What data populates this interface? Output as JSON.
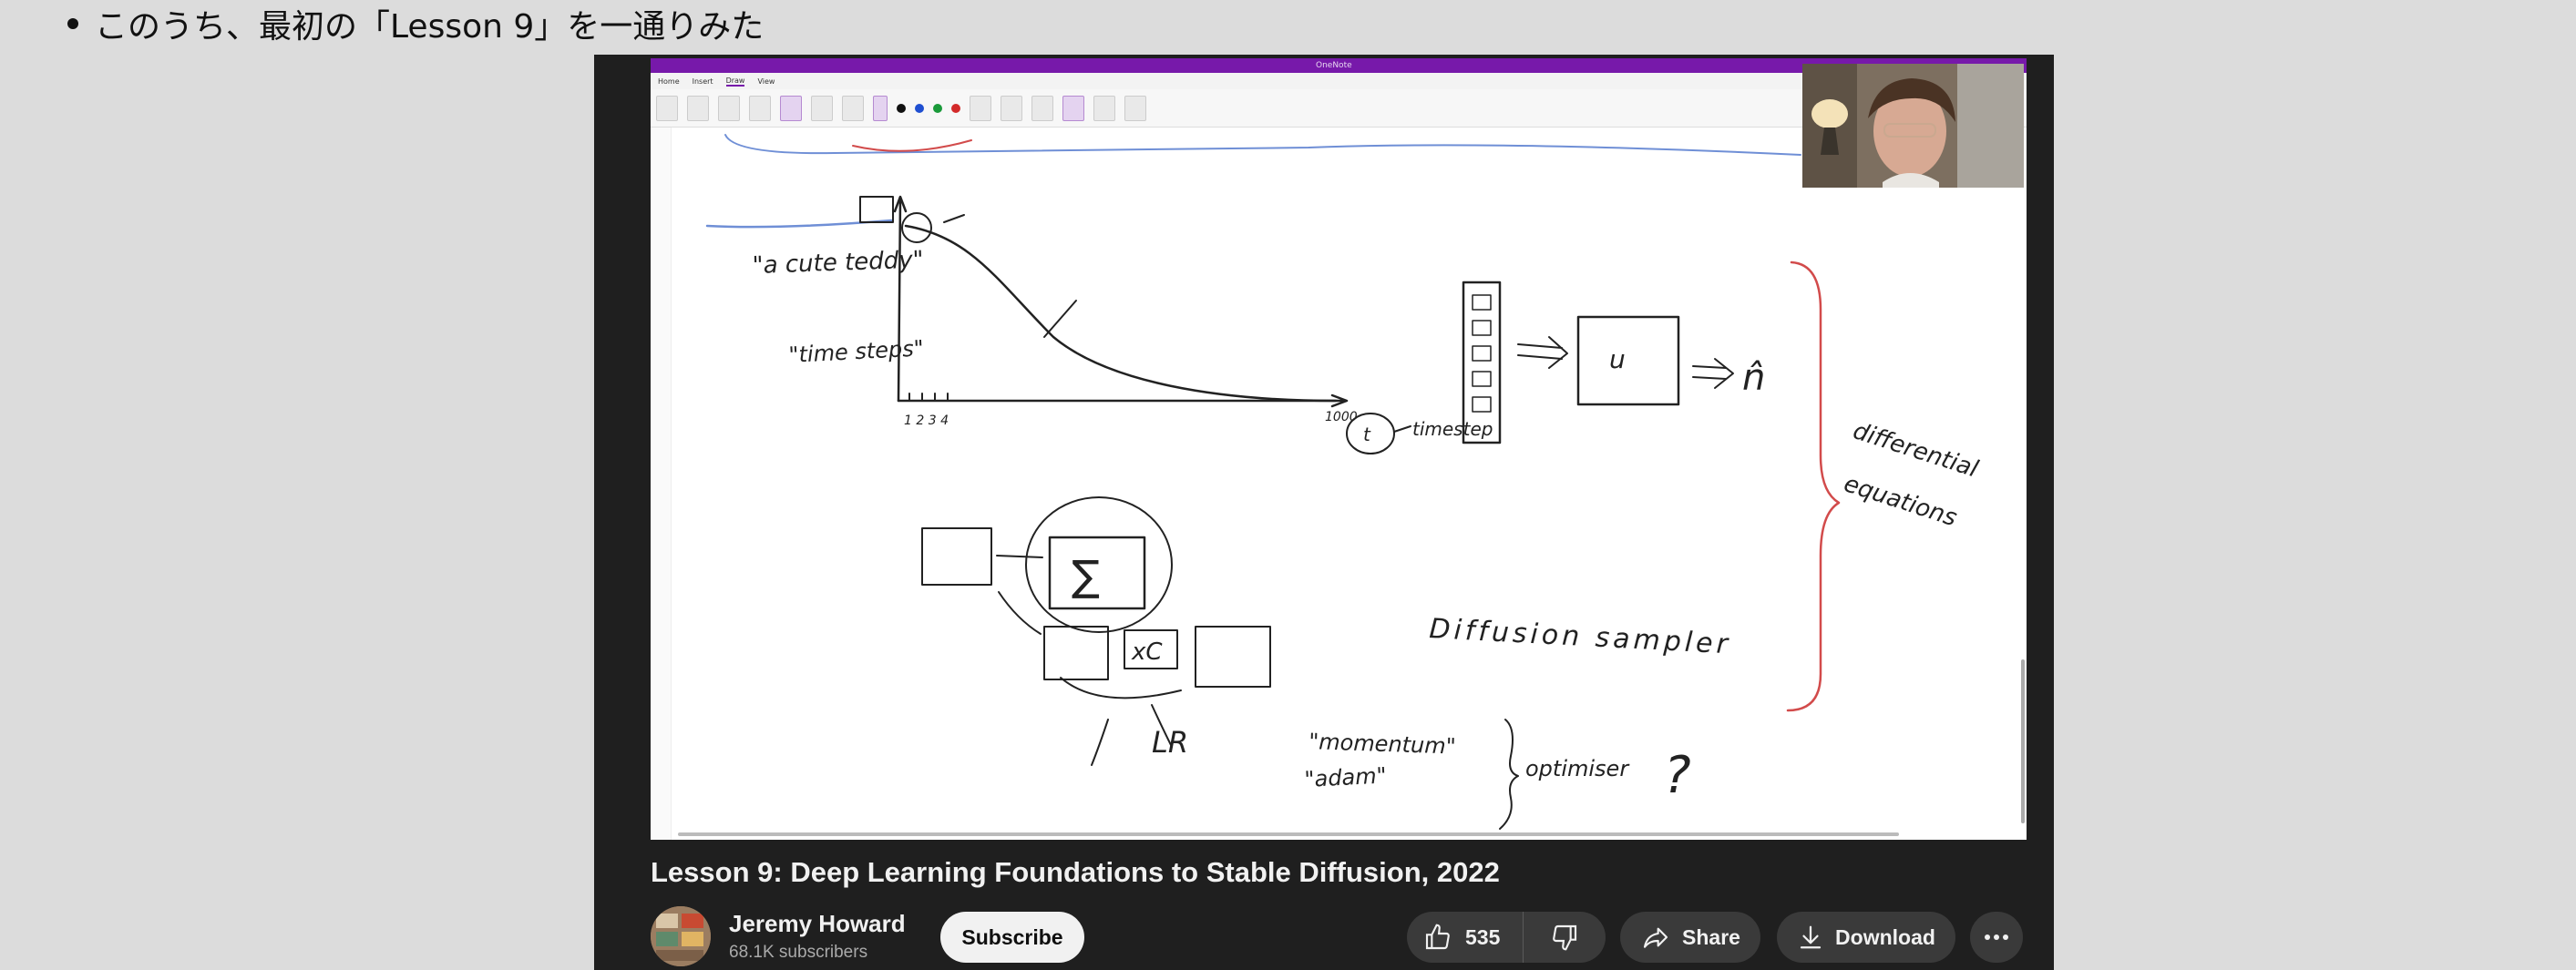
{
  "doc": {
    "bullet_text": "このうち、最初の「Lesson 9」を一通りみた"
  },
  "onenote": {
    "app_title": "OneNote",
    "tabs": [
      "Home",
      "Insert",
      "Draw",
      "View"
    ],
    "active_tab": "Draw",
    "pen_colors": [
      "#111111",
      "#1f4fd1",
      "#1a9a3a",
      "#d32a2a"
    ],
    "handwriting": {
      "teddy": "\"a cute teddy\"",
      "time_steps": "\"time steps\"",
      "x_ticks": "1 2 3 4",
      "x_end": "1000",
      "t": "t",
      "timestep": "timestep",
      "u": "u",
      "n_hat": "n̂",
      "diff_eq_1": "differential",
      "diff_eq_2": "equations",
      "sampler": "Diffusion sampler",
      "sigma": "∑",
      "c": "xC",
      "lr": "LR",
      "momentum": "\"momentum\"",
      "adam": "\"adam\"",
      "optimiser": "optimiser",
      "question": "?"
    }
  },
  "video": {
    "title": "Lesson 9: Deep Learning Foundations to Stable Diffusion, 2022",
    "channel": "Jeremy Howard",
    "subscribers": "68.1K subscribers",
    "subscribe_label": "Subscribe",
    "likes": "535",
    "share_label": "Share",
    "download_label": "Download"
  },
  "colors": {
    "onenote_purple": "#7719aa",
    "player_bg": "#1f1f1f",
    "pill_bg": "#3a3a3a",
    "ink_red": "#d24b4b",
    "ink_blue": "#6f8fd6"
  }
}
